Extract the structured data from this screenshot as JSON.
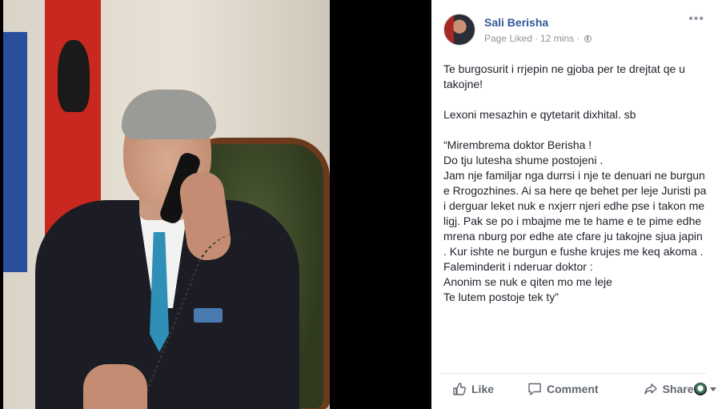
{
  "post": {
    "page_name": "Sali Berisha",
    "page_liked": "Page Liked",
    "separator": "·",
    "time": "12 mins",
    "paragraph1": "Te burgosurit i rrjepin ne gjoba per te drejtat qe u takojne!",
    "paragraph2": "Lexoni mesazhin e qytetarit dixhital. sb",
    "quote": "“Mirembrema doktor Berisha !\nDo tju lutesha shume postojeni .\nJam nje familjar nga durrsi i nje te denuari ne burgun e Rrogozhines. Ai sa here qe behet per leje Juristi pa i derguar leket nuk e nxjerr njeri edhe pse i takon me ligj. Pak se po i mbajme me te hame e te pime edhe mrena nburg por edhe ate cfare ju takojne sjua japin . Kur ishte ne burgun e fushe krujes me keq akoma .\nFaleminderit i nderuar doktor :\nAnonim se nuk e qiten mo me leje\nTe lutem postoje tek ty”"
  },
  "actions": {
    "like": "Like",
    "comment": "Comment",
    "share": "Share"
  },
  "colors": {
    "page_name": "#365899",
    "meta": "#90949c",
    "text": "#1d2129",
    "action": "#616770"
  }
}
